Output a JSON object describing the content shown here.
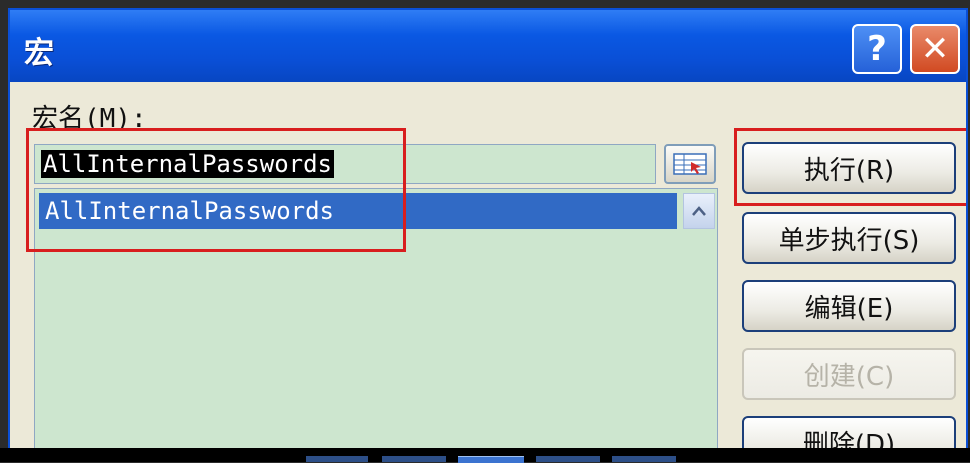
{
  "window": {
    "title": "宏",
    "help_label": "?",
    "close_label": "✕"
  },
  "form": {
    "macro_name_label": "宏名(M):",
    "macro_name_value": "AllInternalPasswords"
  },
  "list": {
    "items": [
      "AllInternalPasswords"
    ]
  },
  "buttons": {
    "run": "执行(R)",
    "step": "单步执行(S)",
    "edit": "编辑(E)",
    "create": "创建(C)",
    "delete": "删除(D)"
  },
  "colors": {
    "title_bar": "#0a4fd6",
    "highlight_box": "#d81e1e",
    "list_background": "#cde6cf",
    "selection": "#316ac5"
  },
  "icons": {
    "macro_picker": "sheet-picker-icon",
    "scroll_up": "scroll-up-arrow-icon"
  }
}
